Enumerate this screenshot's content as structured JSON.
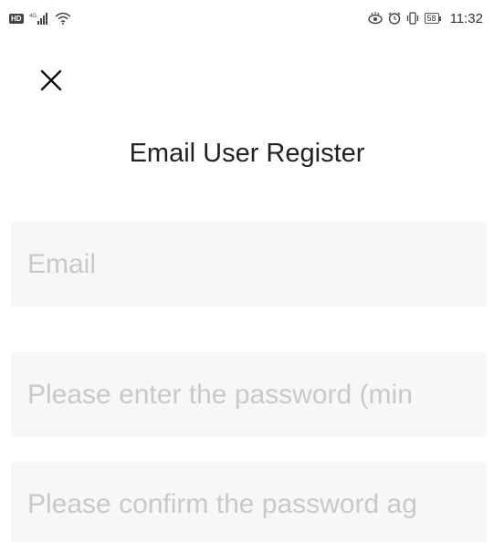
{
  "status_bar": {
    "hd_label": "HD",
    "network_label": "4G",
    "battery_level": "58",
    "time": "11:32",
    "icons": [
      "hd-icon",
      "signal-icon",
      "wifi-icon",
      "eye-icon",
      "alarm-icon",
      "vibrate-icon",
      "battery-icon"
    ]
  },
  "header": {
    "close_icon": "close-icon"
  },
  "page": {
    "title": "Email User Register"
  },
  "form": {
    "email": {
      "placeholder": "Email",
      "value": ""
    },
    "password": {
      "placeholder": "Please enter the password (min",
      "value": ""
    },
    "confirm_password": {
      "placeholder": "Please confirm the password ag",
      "value": ""
    }
  }
}
